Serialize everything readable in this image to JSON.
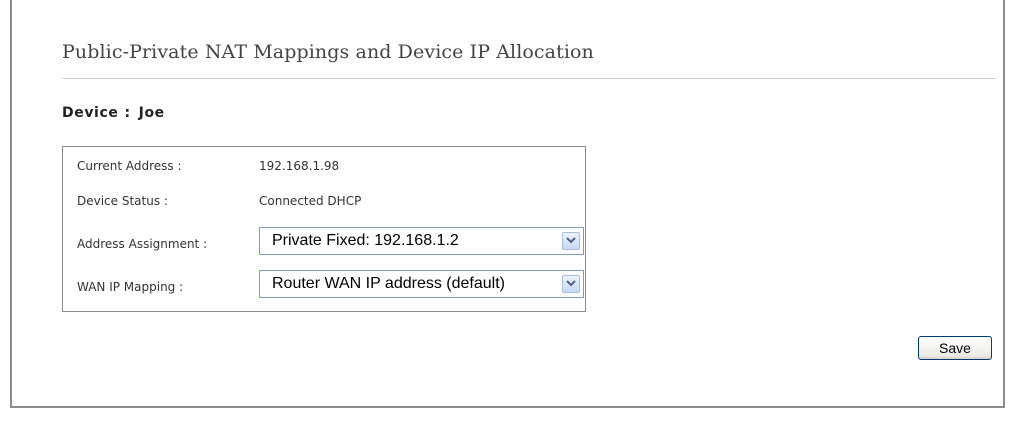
{
  "page": {
    "title": "Public-Private NAT Mappings and Device IP Allocation"
  },
  "device": {
    "label": "Device",
    "separator": ":",
    "name": "Joe"
  },
  "fields": {
    "current_address": {
      "label": "Current Address :",
      "value": "192.168.1.98"
    },
    "device_status": {
      "label": "Device Status :",
      "value": "Connected DHCP"
    },
    "address_assignment": {
      "label": "Address Assignment :",
      "selected": "Private Fixed: 192.168.1.2",
      "icon": "chevron-down-icon"
    },
    "wan_ip_mapping": {
      "label": "WAN IP Mapping :",
      "selected": "Router WAN IP address (default)",
      "icon": "chevron-down-icon"
    }
  },
  "actions": {
    "save_label": "Save"
  }
}
